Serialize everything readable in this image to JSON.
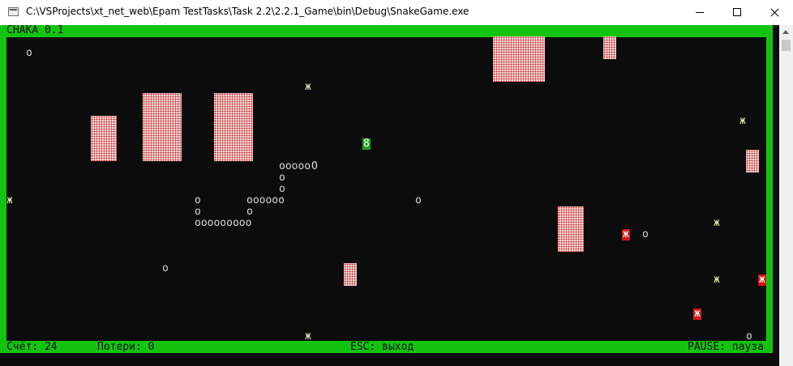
{
  "window": {
    "title": "C:\\VSProjects\\xt_net_web\\Epam TestTasks\\Task 2.2\\2.2.1_Game\\bin\\Debug\\SnakeGame.exe"
  },
  "game": {
    "title": "СНАКА 0.1",
    "status": {
      "score": "Счёт: 24",
      "losses": "Потери: 0",
      "esc_hint": "ESC: выход",
      "pause_hint": "PAUSE: пауза"
    },
    "glyphs": {
      "food": "o",
      "bug": "ж",
      "snake_body": "oooooo",
      "snake_head": "O",
      "head8": "8"
    },
    "colors": {
      "frame": "#13c40f",
      "background": "#0c0c0c",
      "bug_highlight": "#d01818"
    }
  }
}
